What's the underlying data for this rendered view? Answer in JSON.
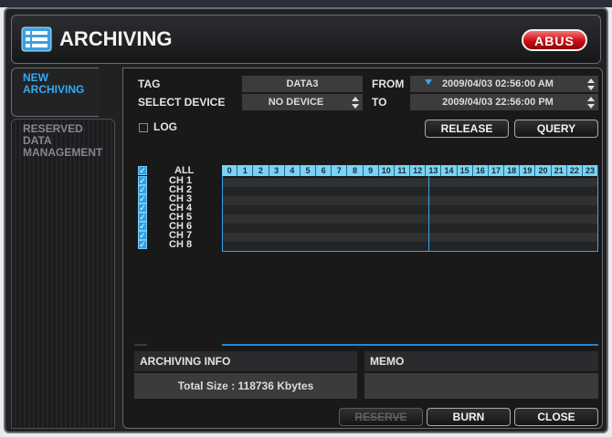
{
  "window": {
    "title": "ARCHIVING",
    "logo": "ABUS",
    "app_icon": "archive-list-icon"
  },
  "sidebar": {
    "items": [
      {
        "label": "NEW ARCHIVING",
        "active": true
      },
      {
        "label": "RESERVED DATA MANAGEMENT",
        "active": false
      }
    ]
  },
  "form": {
    "tag_label": "TAG",
    "tag_value": "DATA3",
    "select_device_label": "SELECT DEVICE",
    "select_device_value": "NO DEVICE",
    "from_label": "FROM",
    "from_value": "2009/04/03 02:56:00 AM",
    "to_label": "TO",
    "to_value": "2009/04/03 22:56:00 PM"
  },
  "log": {
    "label": "LOG",
    "checked": false
  },
  "buttons": {
    "release": "RELEASE",
    "query": "QUERY",
    "reserve": "RESERVE",
    "burn": "BURN",
    "close": "CLOSE"
  },
  "channels": {
    "all_label": "ALL",
    "items": [
      "CH 1",
      "CH 2",
      "CH 3",
      "CH 4",
      "CH 5",
      "CH 6",
      "CH 7",
      "CH 8"
    ]
  },
  "timeline": {
    "hours": [
      "0",
      "1",
      "2",
      "3",
      "4",
      "5",
      "6",
      "7",
      "8",
      "9",
      "10",
      "11",
      "12",
      "13",
      "14",
      "15",
      "16",
      "17",
      "18",
      "19",
      "20",
      "21",
      "22",
      "23"
    ],
    "cursor_hour": 13.2
  },
  "archiving_info": {
    "title": "ARCHIVING INFO",
    "total_size": "Total Size : 118736 Kbytes"
  },
  "memo": {
    "title": "MEMO",
    "value": ""
  },
  "colors": {
    "accent": "#38a8f0",
    "timeline_header": "#79d3f4",
    "logo_red": "#c80d12"
  }
}
